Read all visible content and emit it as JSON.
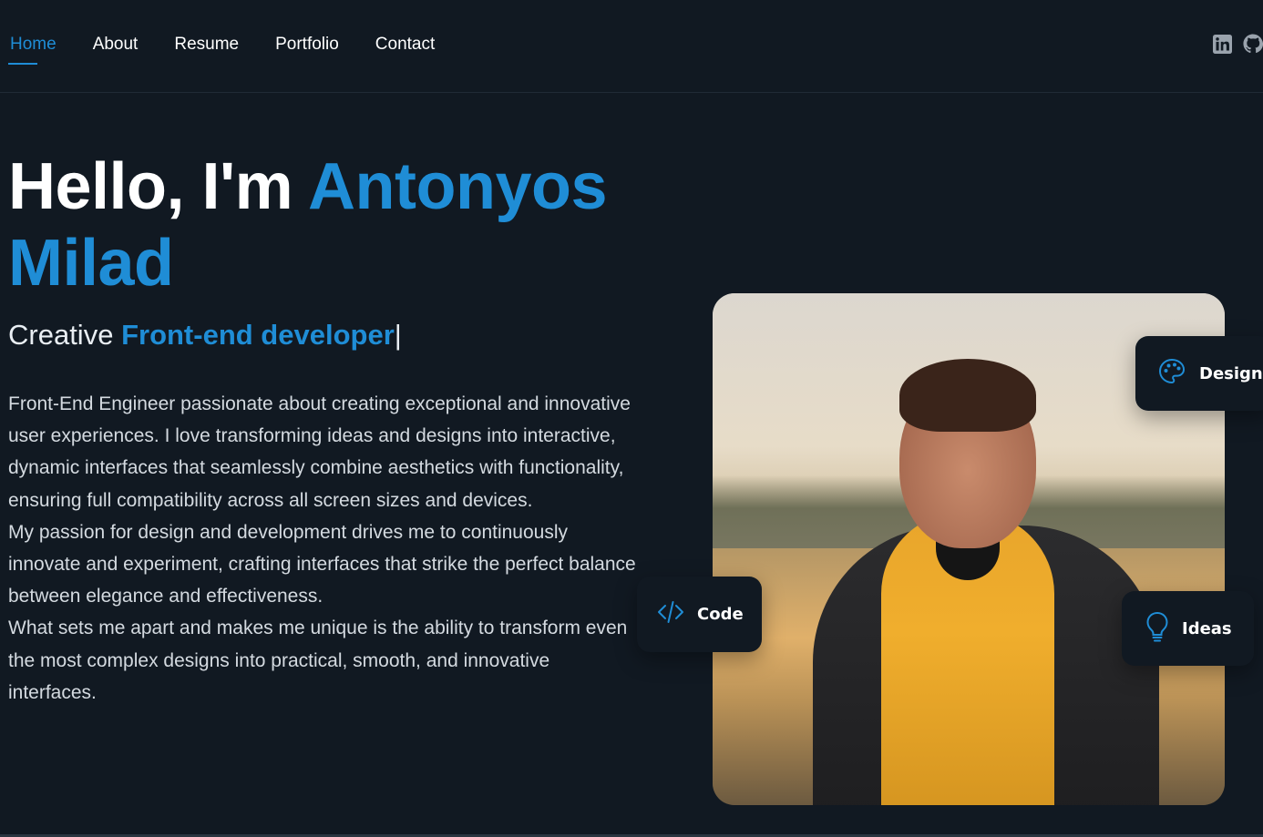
{
  "nav": {
    "items": [
      {
        "label": "Home",
        "active": true
      },
      {
        "label": "About",
        "active": false
      },
      {
        "label": "Resume",
        "active": false
      },
      {
        "label": "Portfolio",
        "active": false
      },
      {
        "label": "Contact",
        "active": false
      }
    ],
    "social": [
      {
        "icon": "linkedin-icon"
      },
      {
        "icon": "github-icon"
      }
    ]
  },
  "hero": {
    "greeting": "Hello, I'm",
    "name_first": "Antonyos",
    "name_last": "Milad",
    "subtitle_prefix": "Creative",
    "subtitle_role": "Front-end developer",
    "cursor": "|"
  },
  "about": {
    "paragraphs": [
      "Front-End Engineer passionate about creating exceptional and innovative user experiences. I love transforming ideas and designs into interactive, dynamic interfaces that seamlessly combine aesthetics with functionality, ensuring full compatibility across all screen sizes and devices.",
      "My passion for design and development drives me to continuously innovate and experiment, crafting interfaces that strike the perfect balance between elegance and effectiveness.",
      "What sets me apart and makes me unique is the ability to transform even the most complex designs into practical, smooth, and innovative interfaces."
    ]
  },
  "badges": {
    "design": {
      "label": "Design",
      "icon": "palette-icon"
    },
    "code": {
      "label": "Code",
      "icon": "code-icon"
    },
    "ideas": {
      "label": "Ideas",
      "icon": "lightbulb-icon"
    }
  },
  "colors": {
    "background": "#111922",
    "accent": "#1f8dd6",
    "text": "#ffffff",
    "muted_text": "#d4dae0"
  }
}
